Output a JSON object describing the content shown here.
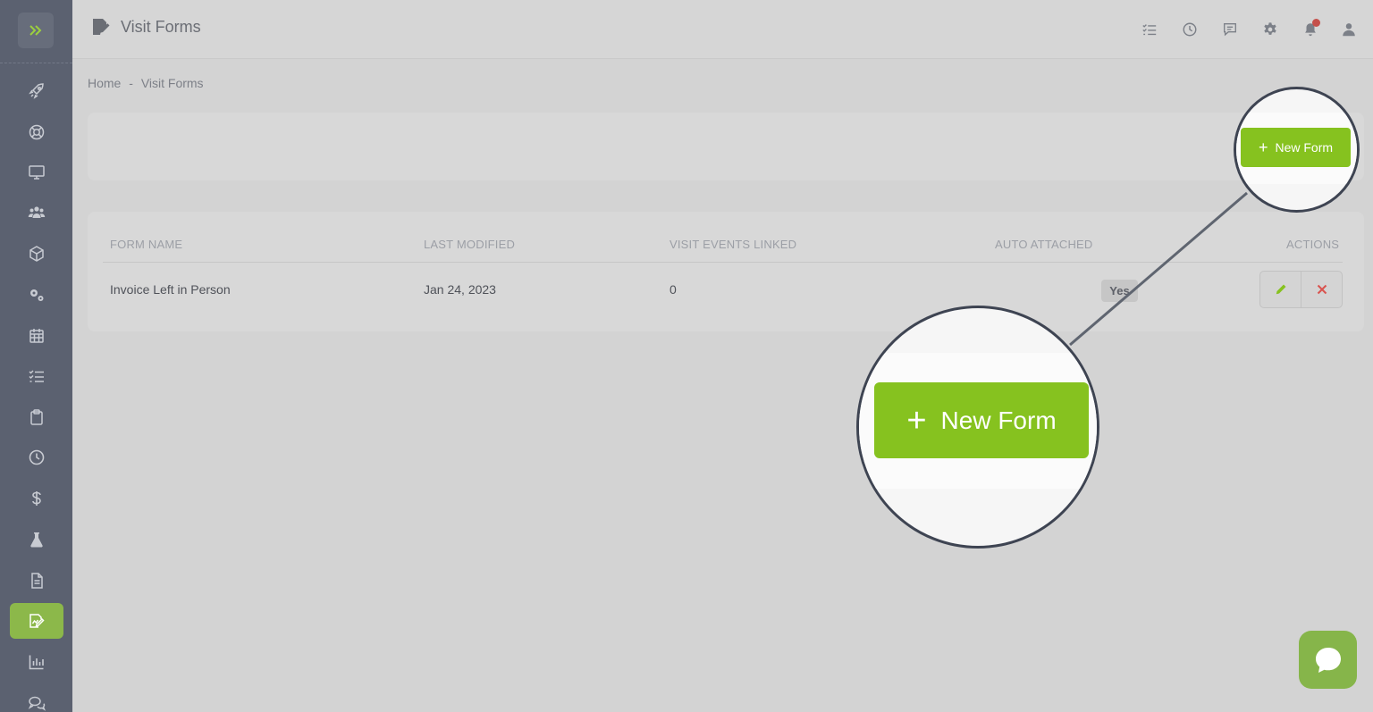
{
  "header": {
    "title": "Visit Forms",
    "icons": [
      "checklist-icon",
      "clock-icon",
      "message-icon",
      "gear-icon",
      "bell-icon",
      "user-icon"
    ]
  },
  "breadcrumb": {
    "home": "Home",
    "separator": "-",
    "current": "Visit Forms"
  },
  "toolbar": {
    "new_form_label": "New Form"
  },
  "table": {
    "columns": [
      "FORM NAME",
      "LAST MODIFIED",
      "VISIT EVENTS LINKED",
      "AUTO ATTACHED",
      "ACTIONS"
    ],
    "rows": [
      {
        "form_name": "Invoice Left in Person",
        "last_modified": "Jan 24, 2023",
        "visit_events_linked": "0",
        "auto_attached": "Yes"
      }
    ]
  },
  "sidebar": {
    "items": [
      "rocket-icon",
      "lifebuoy-icon",
      "monitor-icon",
      "users-icon",
      "box-icon",
      "gears-icon",
      "calendar-icon",
      "list-icon",
      "clipboard-icon",
      "clock-icon",
      "dollar-icon",
      "flask-icon",
      "document-icon",
      "form-edit-icon",
      "bar-chart-icon",
      "chat-icon"
    ],
    "active": "form-edit-icon"
  },
  "colors": {
    "accent_green": "#86c21f",
    "sidebar_bg": "#5b6170",
    "active_item": "#8cb84a",
    "delete_red": "#d9534f"
  }
}
